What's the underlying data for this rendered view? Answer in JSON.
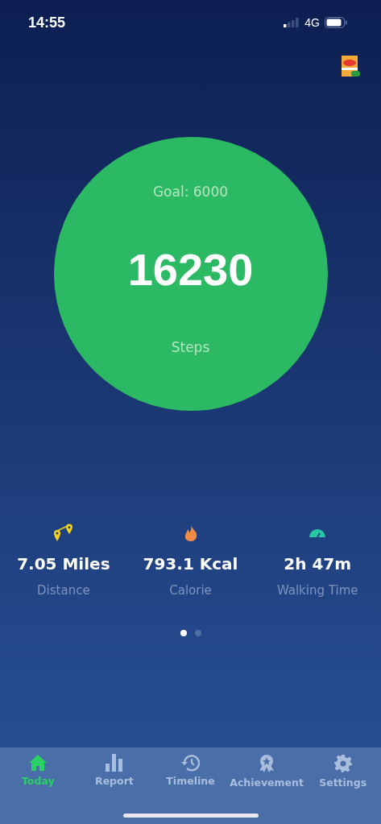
{
  "status_bar": {
    "time": "14:55",
    "network": "4G"
  },
  "ring": {
    "goal": "Goal: 6000",
    "steps": "16230",
    "unit": "Steps"
  },
  "metrics": [
    {
      "kind": "distance",
      "value": "7.05 Miles",
      "label": "Distance"
    },
    {
      "kind": "calorie",
      "value": "793.1 Kcal",
      "label": "Calorie"
    },
    {
      "kind": "time",
      "value": "2h 47m",
      "label": "Walking Time"
    }
  ],
  "pager": [
    {
      "selected": true
    },
    {
      "selected": false
    }
  ],
  "tabs": [
    {
      "kind": "today",
      "label": "Today",
      "selected": true
    },
    {
      "kind": "report",
      "label": "Report",
      "selected": false
    },
    {
      "kind": "timeline",
      "label": "Timeline",
      "selected": false
    },
    {
      "kind": "achievement",
      "label": "Achievement",
      "selected": false
    },
    {
      "kind": "settings",
      "label": "Settings",
      "selected": false
    }
  ]
}
